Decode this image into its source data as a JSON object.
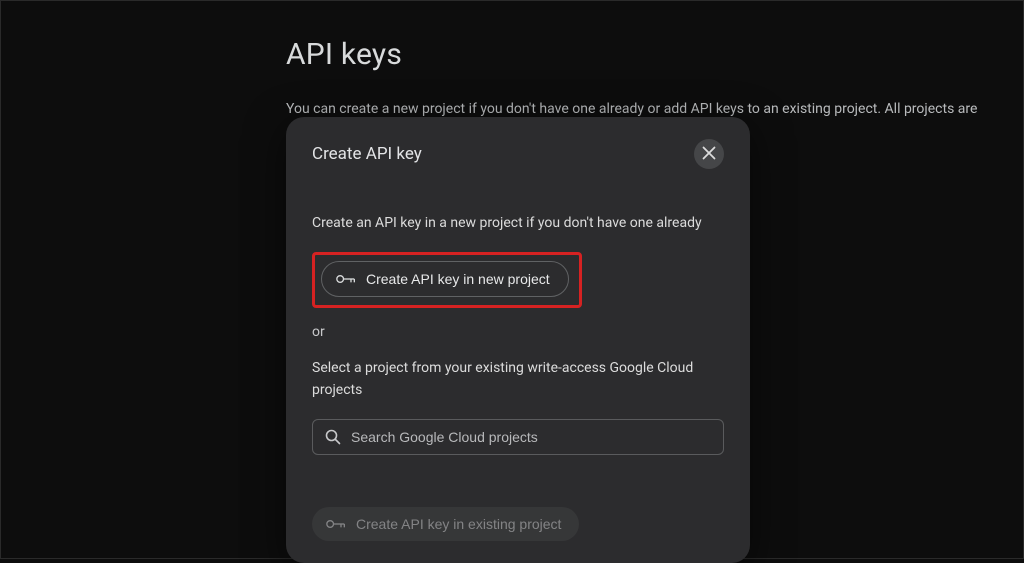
{
  "page": {
    "title": "API keys",
    "description": "You can create a new project if you don't have one already or add API keys to an existing project. All projects are"
  },
  "dialog": {
    "title": "Create API key",
    "intro_text": "Create an API key in a new project if you don't have one already",
    "new_project_button": "Create API key in new project",
    "or_label": "or",
    "select_text": "Select a project from your existing write-access Google Cloud projects",
    "search_placeholder": "Search Google Cloud projects",
    "existing_project_button": "Create API key in existing project"
  }
}
